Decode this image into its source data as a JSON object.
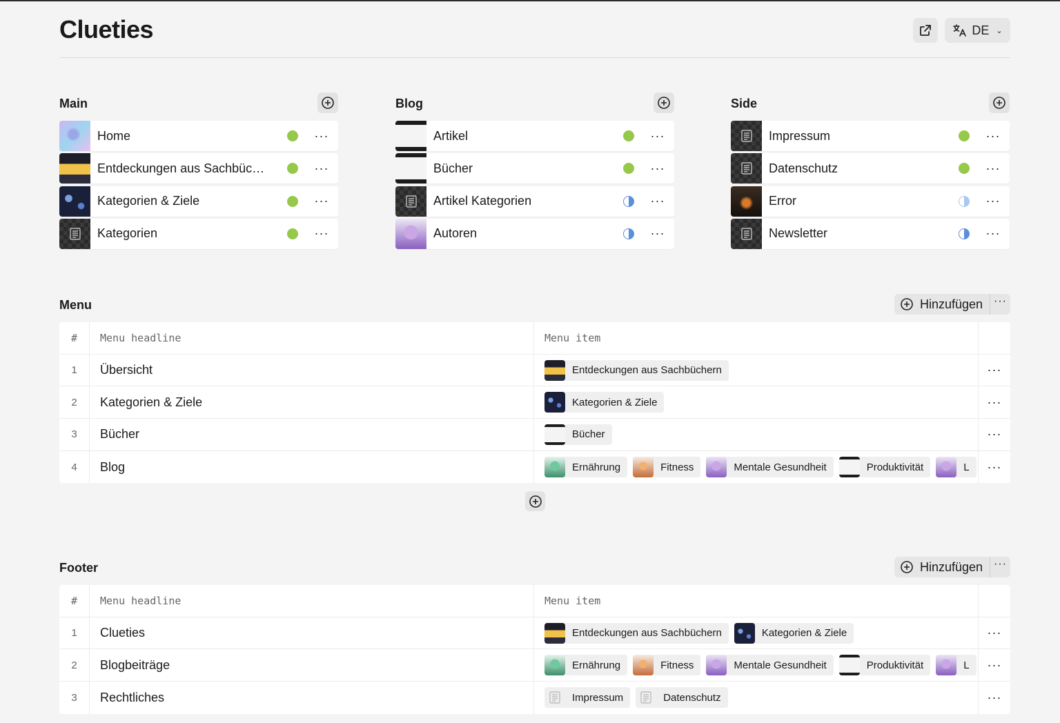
{
  "header": {
    "title": "Clueties",
    "language": "DE",
    "external_icon": "external-link-icon",
    "translate_icon": "translate-icon"
  },
  "groups": [
    {
      "title": "Main",
      "items": [
        {
          "label": "Home",
          "status": "green",
          "thumb": "blurry-gradient"
        },
        {
          "label": "Entdeckungen aus Sachbüchern",
          "status": "green",
          "thumb": "illustration-dark"
        },
        {
          "label": "Kategorien & Ziele",
          "status": "green",
          "thumb": "illustration-navy"
        },
        {
          "label": "Kategorien",
          "status": "green",
          "thumb": "doc"
        }
      ]
    },
    {
      "title": "Blog",
      "items": [
        {
          "label": "Artikel",
          "status": "green",
          "thumb": "light-banner"
        },
        {
          "label": "Bücher",
          "status": "green",
          "thumb": "light-banner"
        },
        {
          "label": "Artikel Kategorien",
          "status": "half",
          "thumb": "doc"
        },
        {
          "label": "Autoren",
          "status": "half",
          "thumb": "illustration-purple"
        }
      ]
    },
    {
      "title": "Side",
      "items": [
        {
          "label": "Impressum",
          "status": "green",
          "thumb": "doc"
        },
        {
          "label": "Datenschutz",
          "status": "green",
          "thumb": "doc"
        },
        {
          "label": "Error",
          "status": "half-light",
          "thumb": "photo-dark"
        },
        {
          "label": "Newsletter",
          "status": "half",
          "thumb": "doc"
        }
      ]
    }
  ],
  "menu": {
    "title": "Menu",
    "add_label": "Hinzufügen",
    "columns": [
      "#",
      "Menu headline",
      "Menu item"
    ],
    "rows": [
      {
        "num": "1",
        "headline": "Übersicht",
        "items": [
          {
            "label": "Entdeckungen aus Sachbüchern",
            "thumb": "illustration-dark"
          }
        ]
      },
      {
        "num": "2",
        "headline": "Kategorien & Ziele",
        "items": [
          {
            "label": "Kategorien & Ziele",
            "thumb": "illustration-navy"
          }
        ]
      },
      {
        "num": "3",
        "headline": "Bücher",
        "items": [
          {
            "label": "Bücher",
            "thumb": "light-banner"
          }
        ]
      },
      {
        "num": "4",
        "headline": "Blog",
        "items": [
          {
            "label": "Ernährung",
            "thumb": "illustration-green"
          },
          {
            "label": "Fitness",
            "thumb": "illustration-orange"
          },
          {
            "label": "Mentale Gesundheit",
            "thumb": "illustration-purple"
          },
          {
            "label": "Produktivität",
            "thumb": "light-banner"
          },
          {
            "label": "L",
            "thumb": "illustration-purple"
          }
        ]
      }
    ]
  },
  "footer": {
    "title": "Footer",
    "add_label": "Hinzufügen",
    "columns": [
      "#",
      "Menu headline",
      "Menu item"
    ],
    "rows": [
      {
        "num": "1",
        "headline": "Clueties",
        "items": [
          {
            "label": "Entdeckungen aus Sachbüchern",
            "thumb": "illustration-dark"
          },
          {
            "label": "Kategorien & Ziele",
            "thumb": "illustration-navy"
          }
        ]
      },
      {
        "num": "2",
        "headline": "Blogbeiträge",
        "items": [
          {
            "label": "Ernährung",
            "thumb": "illustration-green"
          },
          {
            "label": "Fitness",
            "thumb": "illustration-orange"
          },
          {
            "label": "Mentale Gesundheit",
            "thumb": "illustration-purple"
          },
          {
            "label": "Produktivität",
            "thumb": "light-banner"
          },
          {
            "label": "L",
            "thumb": "illustration-purple"
          }
        ]
      },
      {
        "num": "3",
        "headline": "Rechtliches",
        "items": [
          {
            "label": "Impressum",
            "thumb": "doc"
          },
          {
            "label": "Datenschutz",
            "thumb": "doc"
          }
        ]
      }
    ]
  },
  "colors": {
    "status_green": "#96c84a",
    "status_blue": "#5b8fd9",
    "background": "#f4f4f4"
  }
}
